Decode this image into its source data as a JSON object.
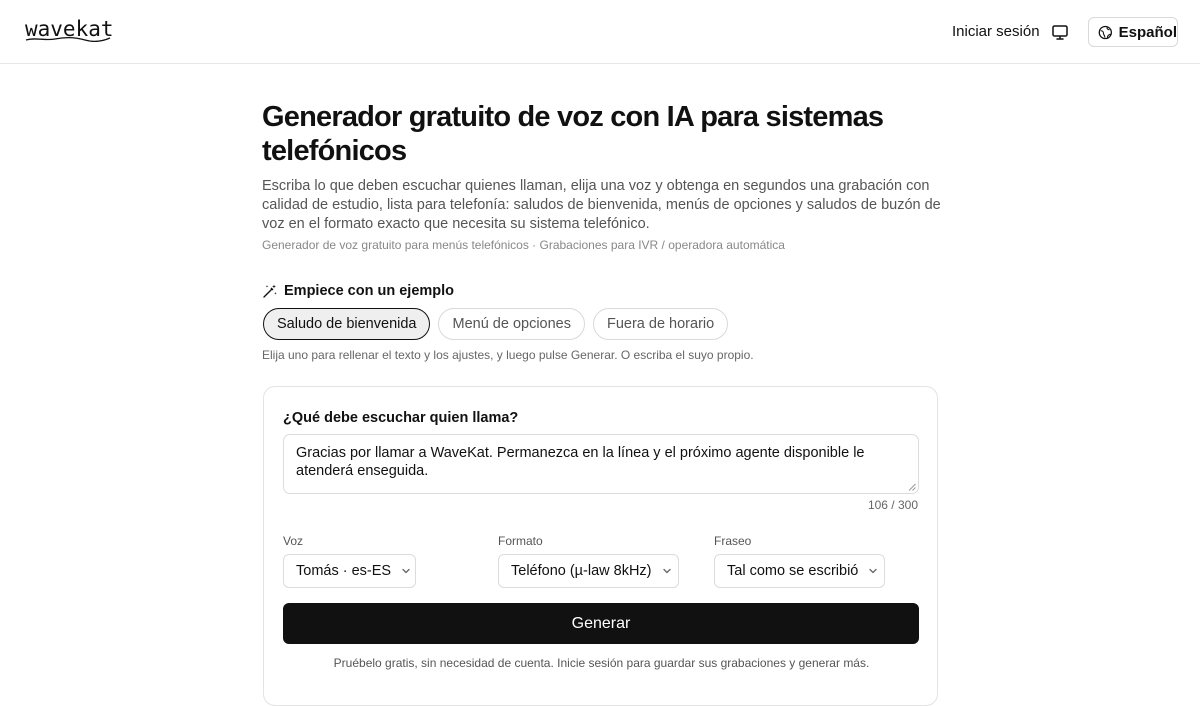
{
  "header": {
    "logo_text": "wavekat",
    "login_label": "Iniciar sesión",
    "display_icon": "monitor-icon",
    "language_label": "Español",
    "language_icon": "globe-icon"
  },
  "hero": {
    "title": "Generador gratuito de voz con IA para sistemas telefónicos",
    "description": "Escriba lo que deben escuchar quienes llaman, elija una voz y obtenga en segundos una grabación con calidad de estudio, lista para telefonía: saludos de bienvenida, menús de opciones y saludos de buzón de voz en el formato exacto que necesita su sistema telefónico.",
    "tagline": "Generador de voz gratuito para menús telefónicos · Grabaciones para IVR / operadora automática"
  },
  "examples": {
    "heading": "Empiece con un ejemplo",
    "heading_icon": "magic-wand-icon",
    "chips": [
      {
        "label": "Saludo de bienvenida",
        "active": true
      },
      {
        "label": "Menú de opciones",
        "active": false
      },
      {
        "label": "Fuera de horario",
        "active": false
      }
    ],
    "hint": "Elija uno para rellenar el texto y los ajustes, y luego pulse Generar. O escriba el suyo propio."
  },
  "form": {
    "prompt_label": "¿Qué debe escuchar quien llama?",
    "prompt_value": "Gracias por llamar a WaveKat. Permanezca en la línea y el próximo agente disponible le atenderá enseguida.",
    "char_count": "106 / 300",
    "voice": {
      "label": "Voz",
      "value": "Tomás · es-ES"
    },
    "format": {
      "label": "Formato",
      "value": "Teléfono (µ-law 8kHz)"
    },
    "phrasing": {
      "label": "Fraseo",
      "value": "Tal como se escribió"
    },
    "generate_label": "Generar",
    "note": "Pruébelo gratis, sin necesidad de cuenta. Inicie sesión para guardar sus grabaciones y generar más."
  }
}
